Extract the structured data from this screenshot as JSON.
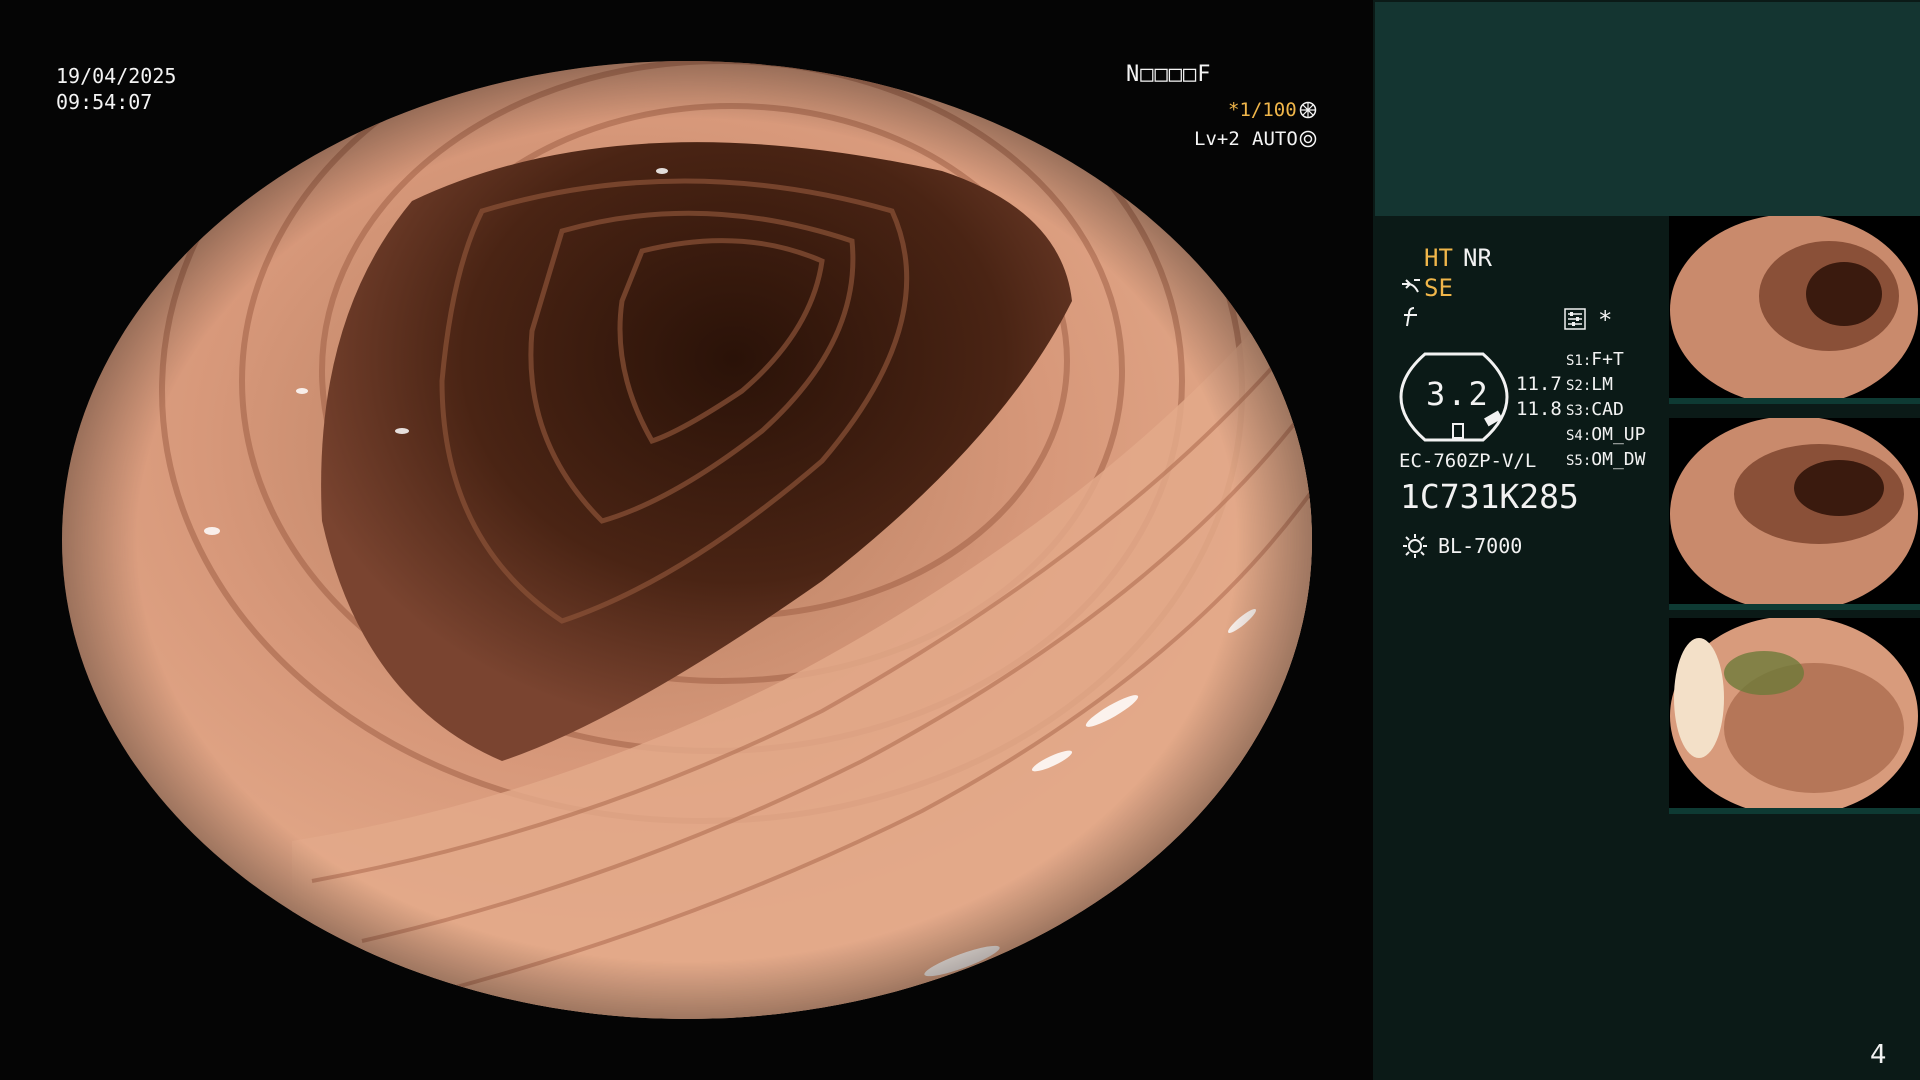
{
  "overlay": {
    "date": "19/04/2025",
    "time": "09:54:07",
    "status_code": "N□□□□F",
    "shutter": "*1/100",
    "level": "Lv+2",
    "mode": "AUTO",
    "icons": [
      "shutter-icon",
      "iris-icon"
    ]
  },
  "panel": {
    "ht": "HT",
    "nr": "NR",
    "se": "SE",
    "asterisk": "*",
    "zoom_value": "3.2",
    "zoom_side_a": "11.7",
    "zoom_side_b": "11.8",
    "slots": [
      {
        "key": "S1:",
        "value": "F+T"
      },
      {
        "key": "S2:",
        "value": "LM"
      },
      {
        "key": "S3:",
        "value": "CAD"
      },
      {
        "key": "S4:",
        "value": "OM_UP"
      },
      {
        "key": "S5:",
        "value": "OM_DW"
      }
    ],
    "scope_model": "EC-760ZP-V/L",
    "serial": "1C731K285",
    "light_source": "BL-7000",
    "page_number": "4",
    "thumbnail_count": 3
  },
  "colors": {
    "accent": "#f0b64a",
    "panel_bg": "#0b1a17",
    "panel_top_bg": "#143531",
    "mucosa": "#c9846a"
  }
}
